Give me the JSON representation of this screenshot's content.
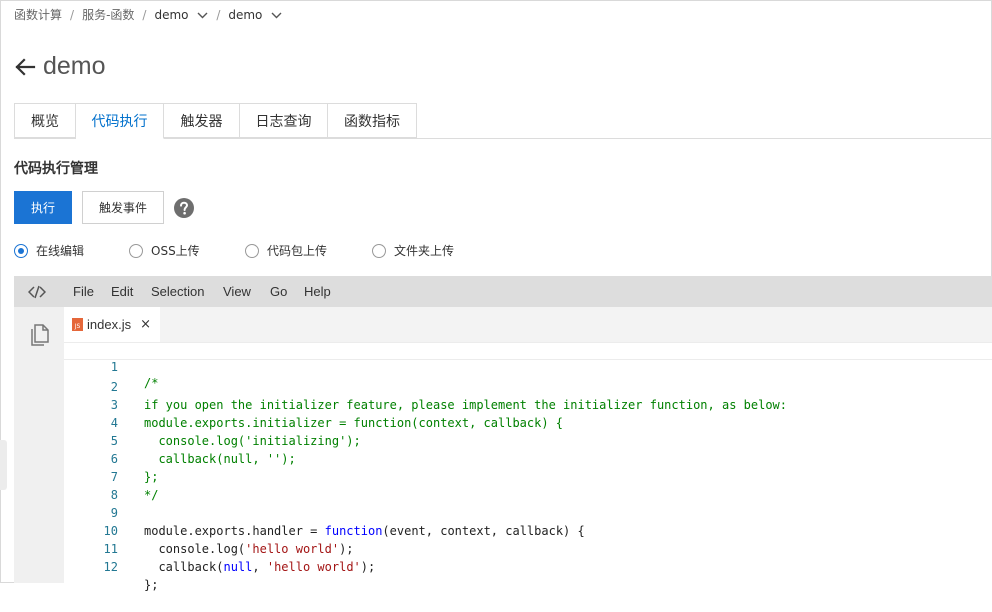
{
  "breadcrumb": {
    "items": [
      "函数计算",
      "服务-函数",
      "demo",
      "demo"
    ],
    "separator": "/"
  },
  "page": {
    "title": "demo"
  },
  "tabs": [
    {
      "label": "概览",
      "active": false
    },
    {
      "label": "代码执行",
      "active": true
    },
    {
      "label": "触发器",
      "active": false
    },
    {
      "label": "日志查询",
      "active": false
    },
    {
      "label": "函数指标",
      "active": false
    }
  ],
  "section": {
    "title": "代码执行管理"
  },
  "actions": {
    "run_label": "执行",
    "trigger_event_label": "触发事件"
  },
  "upload_modes": [
    {
      "label": "在线编辑",
      "checked": true
    },
    {
      "label": "OSS上传",
      "checked": false
    },
    {
      "label": "代码包上传",
      "checked": false
    },
    {
      "label": "文件夹上传",
      "checked": false
    }
  ],
  "editor": {
    "menu": [
      "File",
      "Edit",
      "Selection",
      "View",
      "Go",
      "Help"
    ],
    "file_tab": {
      "name": "index.js",
      "badge": "JS",
      "close": "×"
    },
    "lines": [
      {
        "n": "1",
        "text": "/*"
      },
      {
        "n": "2",
        "text": "if you open the initializer feature, please implement the initializer function, as below:"
      },
      {
        "n": "3",
        "text": "module.exports.initializer = function(context, callback) {"
      },
      {
        "n": "4",
        "text": "  console.log('initializing');"
      },
      {
        "n": "5",
        "text": "  callback(null, '');"
      },
      {
        "n": "6",
        "text": "};"
      },
      {
        "n": "7",
        "text": "*/"
      },
      {
        "n": "8",
        "text": ""
      },
      {
        "n": "9",
        "text": "module.exports.handler = function(event, context, callback) {"
      },
      {
        "n": "10",
        "text": "  console.log('hello world');"
      },
      {
        "n": "11",
        "text": "  callback(null, 'hello world');"
      },
      {
        "n": "12",
        "text": "};"
      }
    ]
  },
  "colors": {
    "primary": "#1b74d4",
    "active_tab": "#0070cc",
    "comment": "#008000",
    "keyword": "#0000ff",
    "string": "#a31515",
    "line_number": "#237893"
  }
}
